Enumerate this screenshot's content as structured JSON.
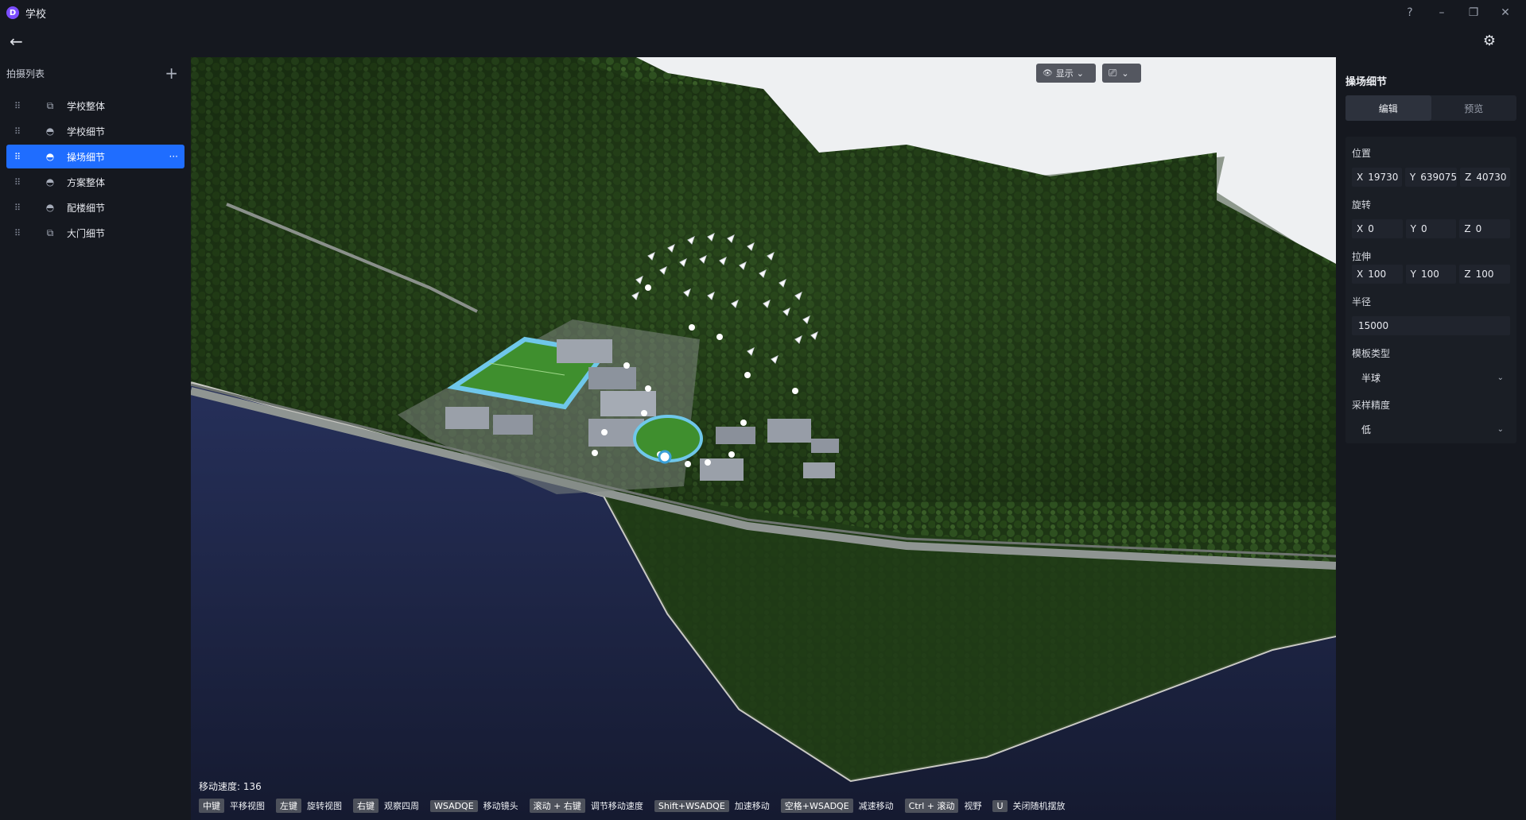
{
  "app": {
    "title": "学校",
    "logo_letter": "D"
  },
  "window_controls": {
    "help": "?",
    "minimize": "–",
    "restore": "❐",
    "close": "✕"
  },
  "toolbar": {
    "back_icon": "←",
    "settings_icon": "⚙"
  },
  "sidebar": {
    "title": "拍摄列表",
    "add_icon": "+",
    "items": [
      {
        "label": "学校整体",
        "icon": "⧉",
        "active": false
      },
      {
        "label": "学校细节",
        "icon": "◓",
        "active": false
      },
      {
        "label": "操场细节",
        "icon": "◓",
        "active": true,
        "more": "···"
      },
      {
        "label": "方案整体",
        "icon": "◓",
        "active": false
      },
      {
        "label": "配楼细节",
        "icon": "◓",
        "active": false
      },
      {
        "label": "大门细节",
        "icon": "⧉",
        "active": false
      }
    ],
    "drag_glyph": "⠿"
  },
  "viewport": {
    "display_button": "显示",
    "eye_icon": "👁",
    "camera_button_icon": "⎚",
    "dropdown_icon": "⌄",
    "speed_text": "移动速度: 136",
    "hints": [
      {
        "key": "中键",
        "text": "平移视图"
      },
      {
        "key": "左键",
        "text": "旋转视图"
      },
      {
        "key": "右键",
        "text": "观察四周"
      },
      {
        "key": "WSADQE",
        "text": "移动镜头"
      },
      {
        "key": "滚动 + 右键",
        "text": "调节移动速度"
      },
      {
        "key": "Shift+WSADQE",
        "text": "加速移动"
      },
      {
        "key": "空格+WSADQE",
        "text": "减速移动"
      },
      {
        "key": "Ctrl + 滚动",
        "text": "视野"
      },
      {
        "key": "U",
        "text": "关闭随机摆放"
      }
    ]
  },
  "panel": {
    "title": "操场细节",
    "tabs": [
      "编辑",
      "预览"
    ],
    "position": {
      "label": "位置",
      "x": "19730",
      "y": "639075",
      "z": "40730"
    },
    "rotation": {
      "label": "旋转",
      "x": "0",
      "y": "0",
      "z": "0"
    },
    "scale": {
      "label": "拉伸",
      "x": "100",
      "y": "100",
      "z": "100"
    },
    "radius": {
      "label": "半径",
      "value": "15000"
    },
    "template_type": {
      "label": "模板类型",
      "value": "半球"
    },
    "sampling": {
      "label": "采样精度",
      "value": "低"
    },
    "axis_labels": {
      "x": "X",
      "y": "Y",
      "z": "Z"
    },
    "chevron": "⌄"
  },
  "colors": {
    "accent": "#1f6dff",
    "bg": "#15181f",
    "forest": "#1f3a18",
    "water": "#1c2440"
  }
}
